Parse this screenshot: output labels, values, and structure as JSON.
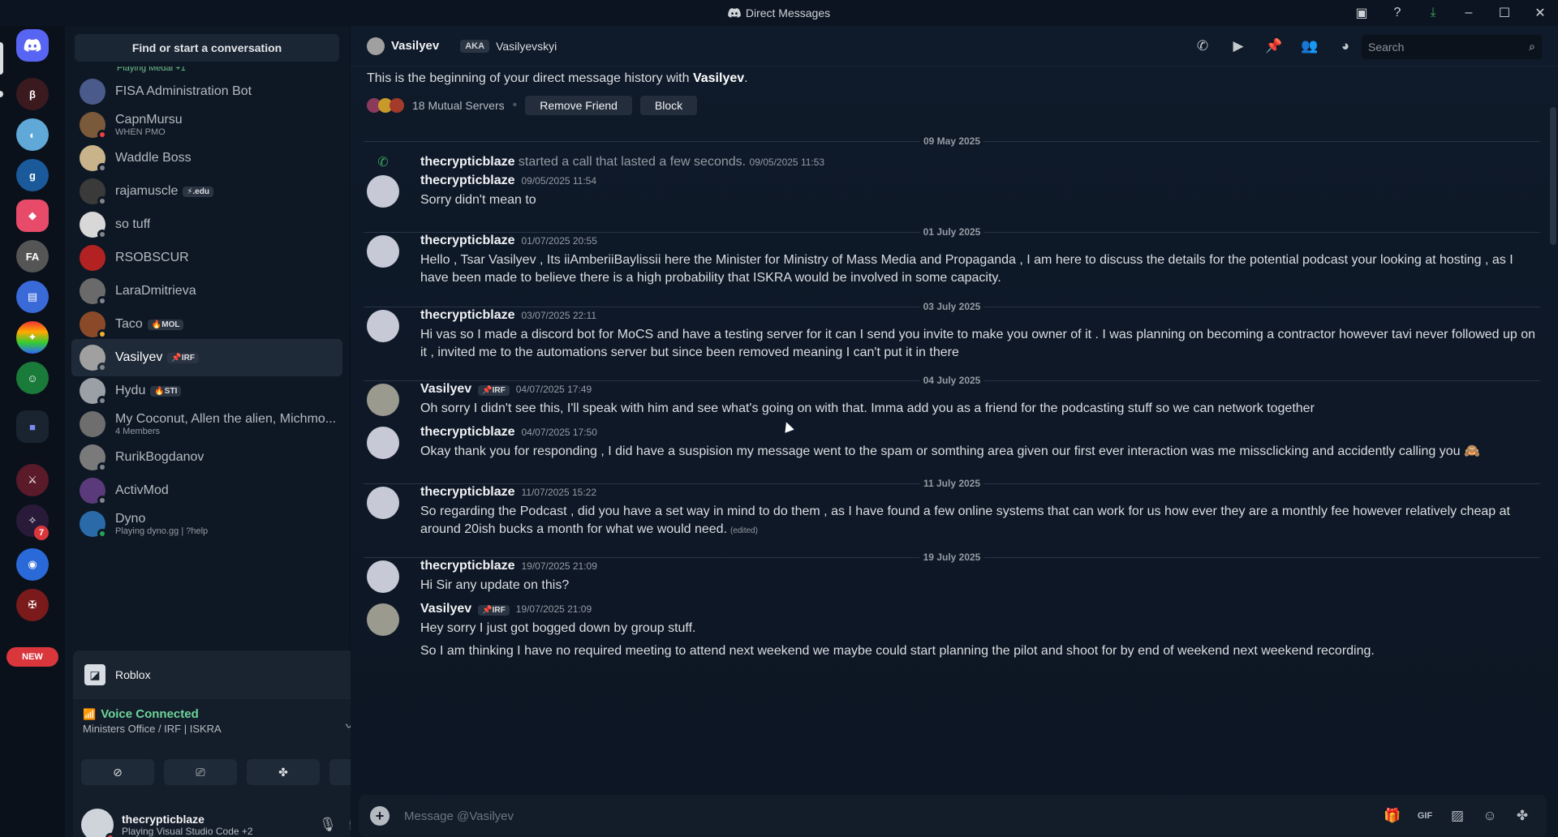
{
  "window": {
    "title": "Direct Messages"
  },
  "sidebar": {
    "find_label": "Find or start a conversation",
    "partial_top_sub": "Playing Medal +1",
    "dms": [
      {
        "name": "FISA Administration Bot",
        "sub": "",
        "tag": "",
        "color": "#4a5a8a",
        "status": ""
      },
      {
        "name": "CapnMursu",
        "sub": "WHEN PMO",
        "tag": "",
        "color": "#7a5a3a",
        "status": "#f23f43"
      },
      {
        "name": "Waddle Boss",
        "sub": "",
        "tag": "",
        "color": "#c9b38a",
        "status": "#80848e"
      },
      {
        "name": "rajamuscle",
        "sub": "",
        "tag": "⚡.edu",
        "color": "#3a3a3a",
        "status": "#80848e"
      },
      {
        "name": "so tuff",
        "sub": "",
        "tag": "",
        "color": "#d8d8d8",
        "status": "#80848e"
      },
      {
        "name": "RSOBSCUR",
        "sub": "",
        "tag": "",
        "color": "#b22222",
        "status": ""
      },
      {
        "name": "LaraDmitrieva",
        "sub": "",
        "tag": "",
        "color": "#6a6a6a",
        "status": "#80848e"
      },
      {
        "name": "Taco",
        "sub": "",
        "tag": "🔥MOL",
        "color": "#8a4a2a",
        "status": "#f0b232"
      },
      {
        "name": "Vasilyev",
        "sub": "",
        "tag": "📌IRF",
        "color": "#a0a0a0",
        "status": "#80848e"
      },
      {
        "name": "Hydu",
        "sub": "",
        "tag": "🔥STI",
        "color": "#9aa0a6",
        "status": "#80848e"
      },
      {
        "name": "My Coconut, Allen the alien, Michmo...",
        "sub": "4 Members",
        "tag": "",
        "color": "#6e6e6e",
        "status": ""
      },
      {
        "name": "RurikBogdanov",
        "sub": "",
        "tag": "",
        "color": "#7a7a7a",
        "status": "#80848e"
      },
      {
        "name": "ActivMod",
        "sub": "",
        "tag": "",
        "color": "#5a3a7a",
        "status": "#80848e"
      },
      {
        "name": "Dyno",
        "sub": "Playing dyno.gg | ?help",
        "tag": "",
        "color": "#2a6aa8",
        "status": "#23a55a"
      }
    ]
  },
  "rail": {
    "new_badge": "NEW",
    "badge_count": "7"
  },
  "activity": {
    "label": "Roblox"
  },
  "voice": {
    "title": "Voice Connected",
    "channel": "Ministers Office / IRF | ISKRA"
  },
  "user": {
    "name": "thecrypticblaze",
    "status": "Playing Visual Studio Code +2"
  },
  "header": {
    "name": "Vasilyev",
    "aka_label": "AKA",
    "aka_name": "Vasilyevskyi",
    "search_placeholder": "Search"
  },
  "chat": {
    "intro_prefix": "This is the beginning of your direct message history with ",
    "intro_name": "Vasilyev",
    "intro_suffix": ".",
    "mutual": "18 Mutual Servers",
    "remove_friend": "Remove Friend",
    "block": "Block",
    "dates": [
      "09 May 2025",
      "01 July 2025",
      "03 July 2025",
      "04 July 2025",
      "11 July 2025",
      "19 July 2025"
    ],
    "call": {
      "author": "thecrypticblaze",
      "text": " started a call that lasted a few seconds.",
      "ts": "09/05/2025 11:53"
    },
    "messages": [
      {
        "author": "thecrypticblaze",
        "tag": "",
        "ts": "09/05/2025 11:54",
        "body": "Sorry didn't mean to"
      },
      {
        "author": "thecrypticblaze",
        "tag": "",
        "ts": "01/07/2025 20:55",
        "body": "Hello , Tsar Vasilyev , Its iiAmberiiBaylissii here the Minister for Ministry of Mass Media and Propaganda , I am here to discuss the details for the potential podcast your looking at hosting , as I have been made to believe there is a high probability that ISKRA would be involved in some capacity."
      },
      {
        "author": "thecrypticblaze",
        "tag": "",
        "ts": "03/07/2025 22:11",
        "body": "Hi vas so I made a discord bot for MoCS and have a testing server for it can I send you invite to make you owner of it . I was planning on becoming a contractor however tavi never followed up on it , invited me to the automations server but since been removed meaning I can't put it in there"
      },
      {
        "author": "Vasilyev",
        "tag": "📌IRF",
        "ts": "04/07/2025 17:49",
        "body": "Oh sorry I didn't see this, I'll speak with him and see what's going on with that. Imma add you as a friend for the podcasting stuff so we can network together"
      },
      {
        "author": "thecrypticblaze",
        "tag": "",
        "ts": "04/07/2025 17:50",
        "body": "Okay thank you for responding , I did have a suspision my message went to the spam or somthing area given our first ever interaction was me missclicking and accidently calling you 🙈"
      },
      {
        "author": "thecrypticblaze",
        "tag": "",
        "ts": "11/07/2025 15:22",
        "body": "So regarding the Podcast , did you have a set way in mind to do them , as I have found a few online systems that can work for us how ever they are a monthly fee however relatively cheap at around 20ish bucks a month for what we would need.",
        "edited": "(edited)"
      },
      {
        "author": "thecrypticblaze",
        "tag": "",
        "ts": "19/07/2025 21:09",
        "body": "Hi Sir any update on this?"
      },
      {
        "author": "Vasilyev",
        "tag": "📌IRF",
        "ts": "19/07/2025 21:09",
        "body": "Hey sorry I just got bogged down by group stuff."
      }
    ],
    "followup": "So I am thinking I have no required meeting to attend next weekend we maybe could start planning the pilot and shoot for by end of weekend next weekend recording."
  },
  "composer": {
    "placeholder": "Message @Vasilyev"
  },
  "icons": {
    "discord": "discord-icon",
    "call": "phone-icon",
    "video": "video-icon",
    "pin": "pin-icon",
    "add_friend": "add-friend-icon",
    "profile": "profile-icon",
    "search": "search-icon",
    "gift": "gift-icon",
    "gif": "gif-icon",
    "sticker": "sticker-icon",
    "emoji": "emoji-icon",
    "apps": "apps-icon"
  },
  "colors": {
    "accent": "#5865f2",
    "online": "#23a55a",
    "dnd": "#f23f43",
    "idle": "#f0b232",
    "new_badge": "#da373c"
  }
}
